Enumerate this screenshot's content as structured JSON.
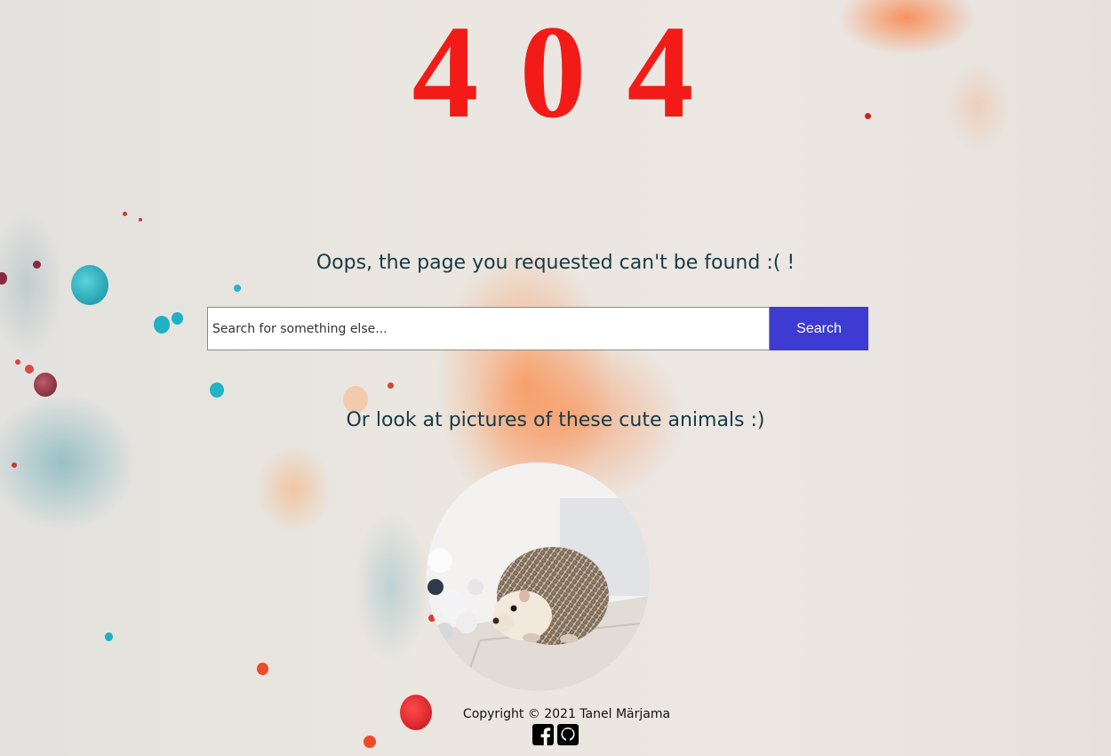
{
  "error": {
    "code": "404",
    "color": "#f21b17"
  },
  "message": {
    "headline": "Oops, the page you requested can't be found :( !",
    "subline": "Or look at pictures of these cute animals :)"
  },
  "search": {
    "placeholder": "Search for something else...",
    "value": "",
    "button_label": "Search",
    "button_color": "#3d3bd1"
  },
  "animal_image": {
    "subject": "hedgehog"
  },
  "footer": {
    "copyright": "Copyright © 2021 Tanel Märjama",
    "social_icons": [
      "facebook-icon",
      "github-icon"
    ]
  }
}
